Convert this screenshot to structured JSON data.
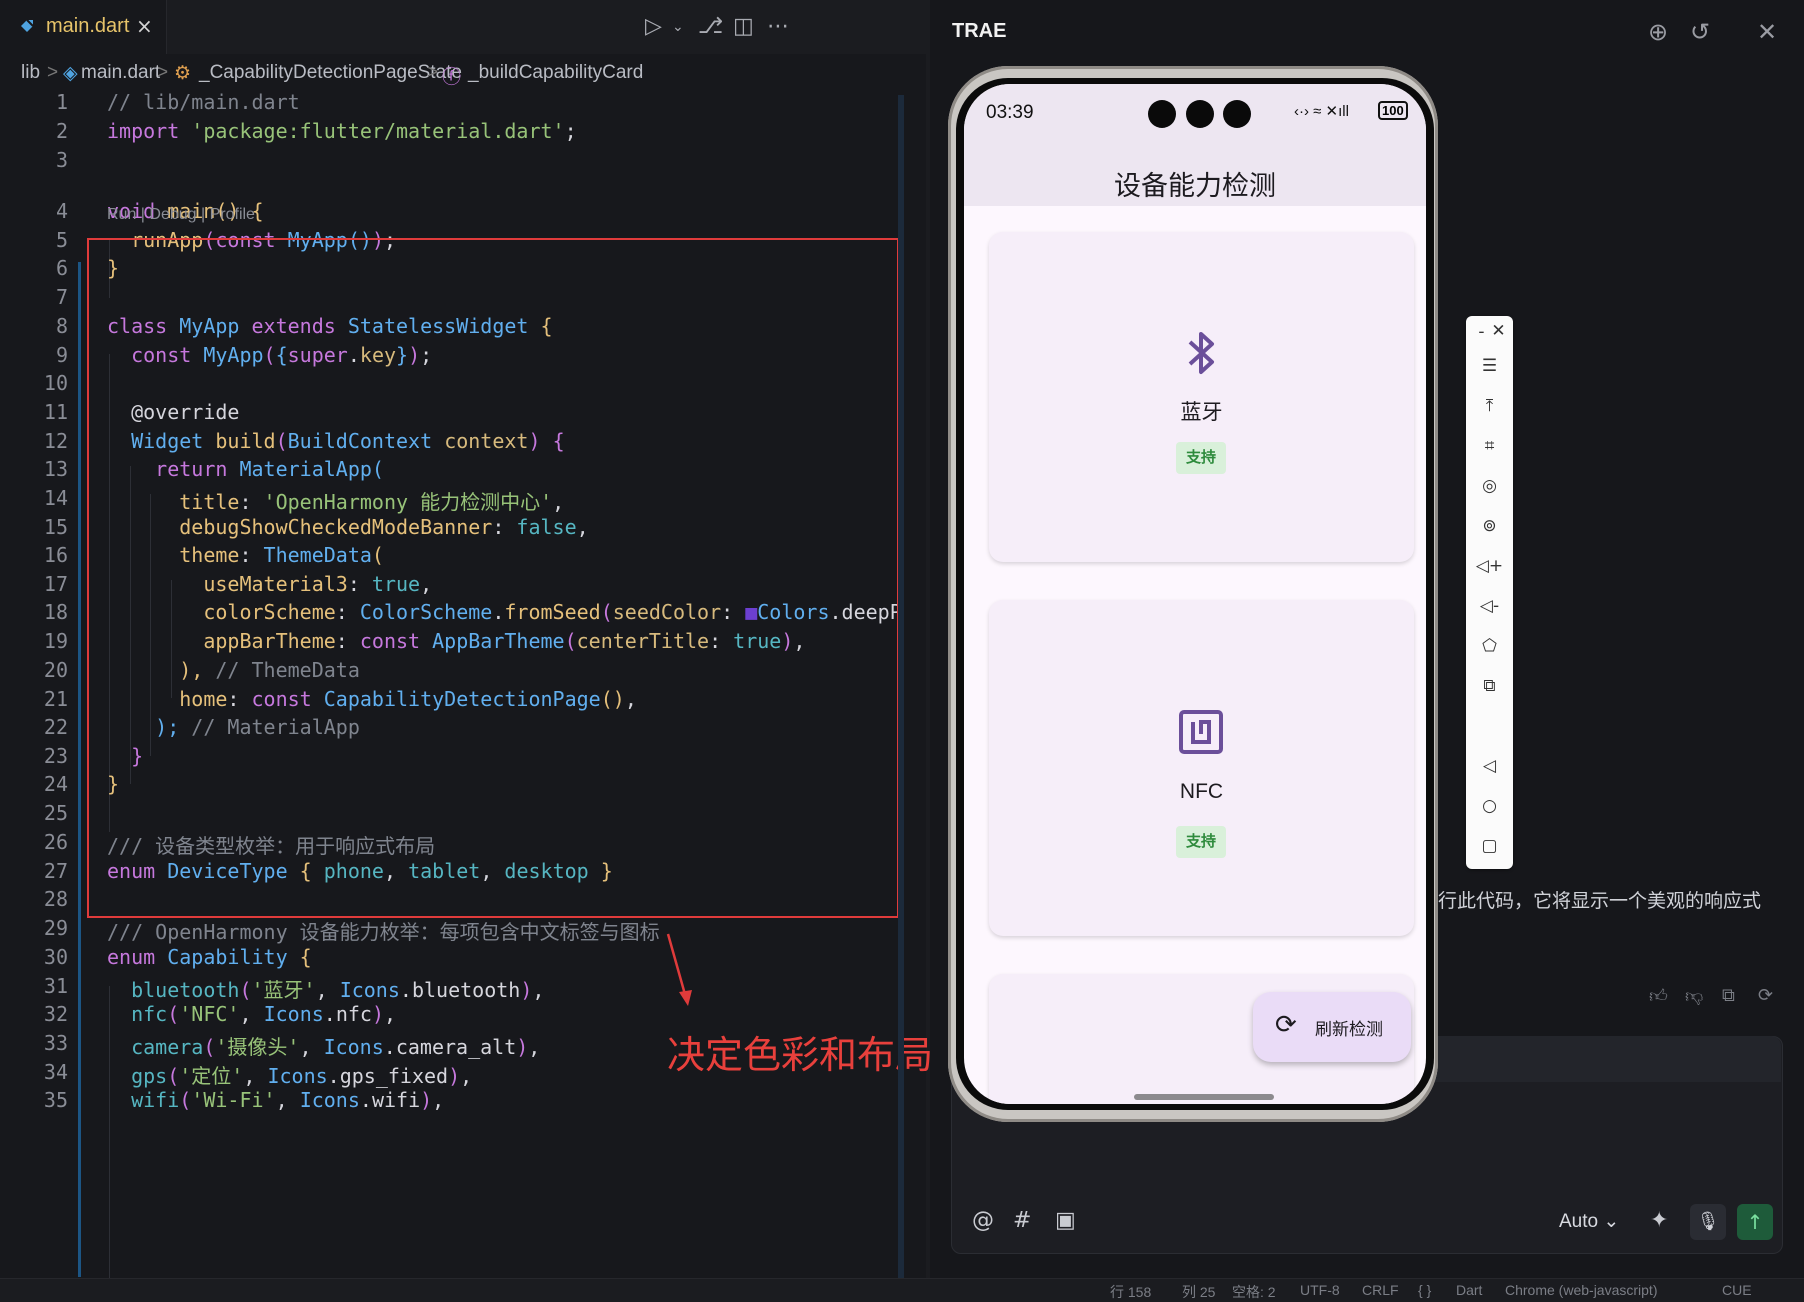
{
  "editor": {
    "tab_label": "main.dart",
    "tab_close": "×",
    "toolbar_icons": [
      "run-debug-icon",
      "chevron-down-icon",
      "source-control-icon",
      "split-editor-icon",
      "more-icon"
    ],
    "breadcrumbs": [
      "lib",
      ">",
      "main.dart",
      ">",
      "_CapabilityDetectionPageState",
      ">",
      "_buildCapabilityCard"
    ],
    "code_lens": "Run | Debug | Profile",
    "annotation": "决定色彩和布局",
    "lines": [
      {
        "n": "1",
        "segs": [
          [
            "// lib/main.dart",
            "cm"
          ]
        ]
      },
      {
        "n": "2",
        "segs": [
          [
            "import ",
            "kw"
          ],
          [
            "'package:flutter/material.dart'",
            "str"
          ],
          [
            ";",
            "plain"
          ]
        ]
      },
      {
        "n": "3",
        "segs": []
      },
      {
        "n": "4",
        "segs": [
          [
            "void ",
            "kw"
          ],
          [
            "main",
            "fn"
          ],
          [
            "() {",
            "br1"
          ]
        ]
      },
      {
        "n": "5",
        "segs": [
          [
            "  runApp",
            "fn"
          ],
          [
            "(",
            "br2"
          ],
          [
            "const ",
            "kw"
          ],
          [
            "MyApp",
            "cls"
          ],
          [
            "()",
            "br3"
          ],
          [
            ")",
            "br2"
          ],
          [
            ";",
            "plain"
          ]
        ]
      },
      {
        "n": "6",
        "segs": [
          [
            "}",
            "br1"
          ]
        ]
      },
      {
        "n": "7",
        "segs": []
      },
      {
        "n": "8",
        "segs": [
          [
            "class ",
            "kw"
          ],
          [
            "MyApp ",
            "cls"
          ],
          [
            "extends ",
            "kw"
          ],
          [
            "StatelessWidget ",
            "cls"
          ],
          [
            "{",
            "br1"
          ]
        ]
      },
      {
        "n": "9",
        "segs": [
          [
            "  const ",
            "kw"
          ],
          [
            "MyApp",
            "cls"
          ],
          [
            "(",
            "br2"
          ],
          [
            "{",
            "br3"
          ],
          [
            "super",
            "kw"
          ],
          [
            ".",
            "plain"
          ],
          [
            "key",
            "pm"
          ],
          [
            "}",
            "br3"
          ],
          [
            ")",
            "br2"
          ],
          [
            ";",
            "plain"
          ]
        ]
      },
      {
        "n": "10",
        "segs": []
      },
      {
        "n": "11",
        "segs": [
          [
            "  @override",
            "plain"
          ]
        ]
      },
      {
        "n": "12",
        "segs": [
          [
            "  Widget ",
            "cls"
          ],
          [
            "build",
            "fn"
          ],
          [
            "(",
            "br2"
          ],
          [
            "BuildContext ",
            "cls"
          ],
          [
            "context",
            "pm"
          ],
          [
            ") {",
            "br2"
          ]
        ]
      },
      {
        "n": "13",
        "segs": [
          [
            "    return ",
            "kw"
          ],
          [
            "MaterialApp",
            "cls"
          ],
          [
            "(",
            "br3"
          ]
        ]
      },
      {
        "n": "14",
        "segs": [
          [
            "      title",
            "fld"
          ],
          [
            ": ",
            "plain"
          ],
          [
            "'OpenHarmony 能力检测中心'",
            "str"
          ],
          [
            ",",
            "plain"
          ]
        ]
      },
      {
        "n": "15",
        "segs": [
          [
            "      debugShowCheckedModeBanner",
            "fld"
          ],
          [
            ": ",
            "plain"
          ],
          [
            "false",
            "lit"
          ],
          [
            ",",
            "plain"
          ]
        ]
      },
      {
        "n": "16",
        "segs": [
          [
            "      theme",
            "fld"
          ],
          [
            ": ",
            "plain"
          ],
          [
            "ThemeData",
            "cls"
          ],
          [
            "(",
            "br1"
          ]
        ]
      },
      {
        "n": "17",
        "segs": [
          [
            "        useMaterial3",
            "fld"
          ],
          [
            ": ",
            "plain"
          ],
          [
            "true",
            "lit"
          ],
          [
            ",",
            "plain"
          ]
        ]
      },
      {
        "n": "18",
        "segs": [
          [
            "        colorScheme",
            "fld"
          ],
          [
            ": ",
            "plain"
          ],
          [
            "ColorScheme",
            "cls"
          ],
          [
            ".",
            "plain"
          ],
          [
            "fromSeed",
            "fn"
          ],
          [
            "(",
            "br2"
          ],
          [
            "seedColor",
            "pm"
          ],
          [
            ": ",
            "plain"
          ],
          [
            "■",
            "swatch"
          ],
          [
            "Colors",
            "cls"
          ],
          [
            ".deepPu",
            "plain"
          ]
        ]
      },
      {
        "n": "19",
        "segs": [
          [
            "        appBarTheme",
            "fld"
          ],
          [
            ": ",
            "plain"
          ],
          [
            "const ",
            "kw"
          ],
          [
            "AppBarTheme",
            "cls"
          ],
          [
            "(",
            "br2"
          ],
          [
            "centerTitle",
            "pm"
          ],
          [
            ": ",
            "plain"
          ],
          [
            "true",
            "lit"
          ],
          [
            ")",
            "br2"
          ],
          [
            ",",
            "plain"
          ]
        ]
      },
      {
        "n": "20",
        "segs": [
          [
            "      ),",
            "br1"
          ],
          [
            " // ThemeData",
            "cm"
          ]
        ]
      },
      {
        "n": "21",
        "segs": [
          [
            "      home",
            "fld"
          ],
          [
            ": ",
            "plain"
          ],
          [
            "const ",
            "kw"
          ],
          [
            "CapabilityDetectionPage",
            "cls"
          ],
          [
            "()",
            "br1"
          ],
          [
            ",",
            "plain"
          ]
        ]
      },
      {
        "n": "22",
        "segs": [
          [
            "    );",
            "br3"
          ],
          [
            " // MaterialApp",
            "cm"
          ]
        ]
      },
      {
        "n": "23",
        "segs": [
          [
            "  }",
            "br2"
          ]
        ]
      },
      {
        "n": "24",
        "segs": [
          [
            "}",
            "br1"
          ]
        ]
      },
      {
        "n": "25",
        "segs": []
      },
      {
        "n": "26",
        "segs": [
          [
            "/// 设备类型枚举：用于响应式布局",
            "cm"
          ]
        ]
      },
      {
        "n": "27",
        "segs": [
          [
            "enum ",
            "kw"
          ],
          [
            "DeviceType ",
            "cls"
          ],
          [
            "{ ",
            "br1"
          ],
          [
            "phone",
            "lit"
          ],
          [
            ", ",
            "plain"
          ],
          [
            "tablet",
            "lit"
          ],
          [
            ", ",
            "plain"
          ],
          [
            "desktop",
            "lit"
          ],
          [
            " }",
            "br1"
          ]
        ]
      },
      {
        "n": "28",
        "segs": []
      },
      {
        "n": "29",
        "segs": [
          [
            "/// OpenHarmony 设备能力枚举：每项包含中文标签与图标",
            "cm"
          ]
        ]
      },
      {
        "n": "30",
        "segs": [
          [
            "enum ",
            "kw"
          ],
          [
            "Capability ",
            "cls"
          ],
          [
            "{",
            "br1"
          ]
        ]
      },
      {
        "n": "31",
        "segs": [
          [
            "  bluetooth",
            "lit"
          ],
          [
            "(",
            "br2"
          ],
          [
            "'蓝牙'",
            "str"
          ],
          [
            ", ",
            "plain"
          ],
          [
            "Icons",
            "cls"
          ],
          [
            ".bluetooth",
            "plain"
          ],
          [
            ")",
            "br2"
          ],
          [
            ",",
            "plain"
          ]
        ]
      },
      {
        "n": "32",
        "segs": [
          [
            "  nfc",
            "lit"
          ],
          [
            "(",
            "br2"
          ],
          [
            "'NFC'",
            "str"
          ],
          [
            ", ",
            "plain"
          ],
          [
            "Icons",
            "cls"
          ],
          [
            ".nfc",
            "plain"
          ],
          [
            ")",
            "br2"
          ],
          [
            ",",
            "plain"
          ]
        ]
      },
      {
        "n": "33",
        "segs": [
          [
            "  camera",
            "lit"
          ],
          [
            "(",
            "br2"
          ],
          [
            "'摄像头'",
            "str"
          ],
          [
            ", ",
            "plain"
          ],
          [
            "Icons",
            "cls"
          ],
          [
            ".camera_alt",
            "plain"
          ],
          [
            ")",
            "br2"
          ],
          [
            ",",
            "plain"
          ]
        ]
      },
      {
        "n": "34",
        "segs": [
          [
            "  gps",
            "lit"
          ],
          [
            "(",
            "br2"
          ],
          [
            "'定位'",
            "str"
          ],
          [
            ", ",
            "plain"
          ],
          [
            "Icons",
            "cls"
          ],
          [
            ".gps_fixed",
            "plain"
          ],
          [
            ")",
            "br2"
          ],
          [
            ",",
            "plain"
          ]
        ]
      },
      {
        "n": "35",
        "segs": [
          [
            "  wifi",
            "lit"
          ],
          [
            "(",
            "br2"
          ],
          [
            "'Wi-Fi'",
            "str"
          ],
          [
            ", ",
            "plain"
          ],
          [
            "Icons",
            "cls"
          ],
          [
            ".wifi",
            "plain"
          ],
          [
            ")",
            "br2"
          ],
          [
            ",",
            "plain"
          ]
        ]
      }
    ]
  },
  "panel": {
    "title": "TRAE",
    "header_icons": [
      "new-chat-icon",
      "history-icon",
      "close-icon"
    ],
    "chat_text": "行此代码，它将显示一个美观的响应式",
    "input": {
      "mode": "Auto",
      "tools": [
        "@",
        "#",
        "image-icon"
      ]
    }
  },
  "phone": {
    "time": "03:39",
    "status_icons": "‹·› ≈ ✕ıll",
    "battery": "100",
    "app_title": "设备能力检测",
    "cards": [
      {
        "label": "蓝牙",
        "badge": "支持",
        "icon": "bluetooth-icon"
      },
      {
        "label": "NFC",
        "badge": "支持",
        "icon": "nfc-icon"
      }
    ],
    "fab_label": "刷新检测"
  },
  "status_bar": [
    "行 158",
    "列 25",
    "空格: 2",
    "UTF-8",
    "CRLF",
    "{ }",
    "Dart",
    "Chrome (web-javascript)",
    "CUE"
  ],
  "colors": {
    "accent_red": "#e03b3b",
    "seed_color": "#6c3fd0",
    "badge_green": "#2e8b3c",
    "send_green": "#1e5b3a"
  }
}
